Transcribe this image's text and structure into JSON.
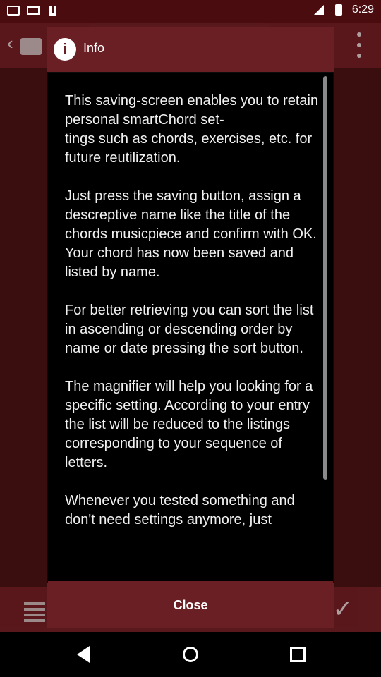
{
  "status": {
    "time": "6:29",
    "left_icons": [
      "app-icon",
      "mail-icon",
      "download-icon"
    ],
    "right_icons": [
      "signal-icon",
      "battery-icon"
    ]
  },
  "dialog": {
    "title": "Info",
    "body": "This saving-screen enables you to retain personal smartChord set-\ntings such as chords, exercises, etc. for future reutilization.\n\nJust press the saving button, assign a descreptive name like the title of the chords musicpiece and confirm with OK. Your chord has now been saved and listed by name.\n\nFor better retrieving you can sort the list in ascending or descending order by name or date pressing the sort button.\n\nThe magnifier will help you looking for a specific setting. According to your entry the list will be reduced to the listings corresponding to your sequence of letters.\n\nWhenever you tested something and don't need settings anymore, just",
    "close_label": "Close"
  },
  "background": {
    "top_bar_icons": [
      "back-icon",
      "folder-icon",
      "overflow-menu-icon"
    ],
    "bottom_bar_icons": [
      "list-icon",
      "check-icon"
    ]
  },
  "colors": {
    "header": "#6a1f24",
    "statusbar": "#4a0c0f",
    "dialog_bg": "#000000",
    "text": "#f1f1f1"
  }
}
